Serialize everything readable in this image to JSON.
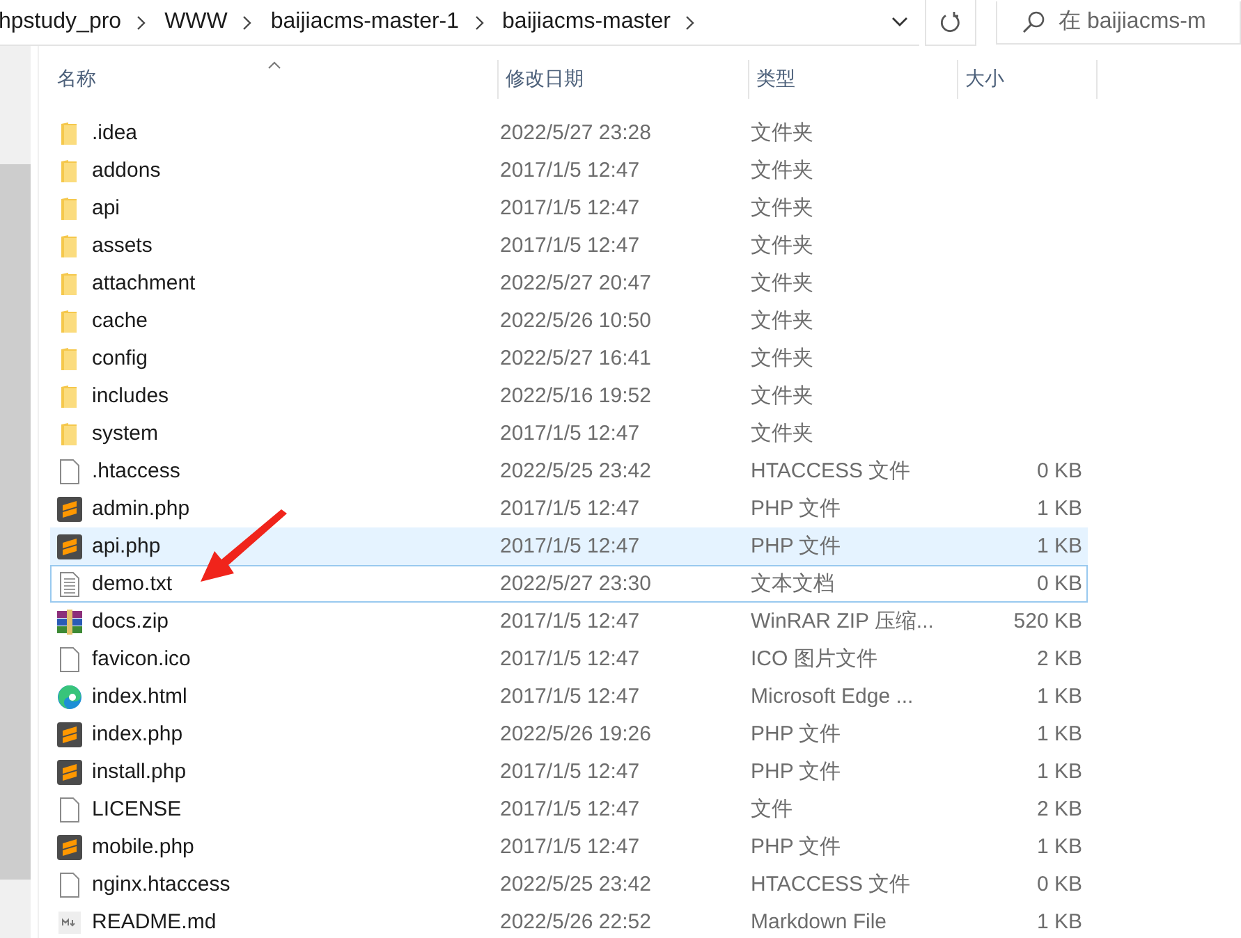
{
  "breadcrumb": [
    "hpstudy_pro",
    "WWW",
    "baijiacms-master-1",
    "baijiacms-master"
  ],
  "search": {
    "placeholder": "在 baijiacms-m"
  },
  "columns": [
    {
      "label": "名称",
      "sorted": true
    },
    {
      "label": "修改日期",
      "sorted": false
    },
    {
      "label": "类型",
      "sorted": false
    },
    {
      "label": "大小",
      "sorted": false
    }
  ],
  "files": [
    {
      "kind": "folder",
      "name": ".idea",
      "modified": "2022/5/27 23:28",
      "type": "文件夹",
      "hovered": false,
      "focused": false
    },
    {
      "kind": "folder",
      "name": "addons",
      "modified": "2017/1/5 12:47",
      "type": "文件夹",
      "hovered": false,
      "focused": false
    },
    {
      "kind": "folder",
      "name": "api",
      "modified": "2017/1/5 12:47",
      "type": "文件夹",
      "hovered": false,
      "focused": false
    },
    {
      "kind": "folder",
      "name": "assets",
      "modified": "2017/1/5 12:47",
      "type": "文件夹",
      "hovered": false,
      "focused": false
    },
    {
      "kind": "folder",
      "name": "attachment",
      "modified": "2022/5/27 20:47",
      "type": "文件夹",
      "hovered": false,
      "focused": false
    },
    {
      "kind": "folder",
      "name": "cache",
      "modified": "2022/5/26 10:50",
      "type": "文件夹",
      "hovered": false,
      "focused": false
    },
    {
      "kind": "folder",
      "name": "config",
      "modified": "2022/5/27 16:41",
      "type": "文件夹",
      "hovered": false,
      "focused": false
    },
    {
      "kind": "folder",
      "name": "includes",
      "modified": "2022/5/16 19:52",
      "type": "文件夹",
      "hovered": false,
      "focused": false
    },
    {
      "kind": "folder",
      "name": "system",
      "modified": "2017/1/5 12:47",
      "type": "文件夹",
      "hovered": false,
      "focused": false
    },
    {
      "kind": "blank",
      "name": ".htaccess",
      "modified": "2022/5/25 23:42",
      "type": "HTACCESS 文件",
      "size": "0 KB",
      "hovered": false,
      "focused": false
    },
    {
      "kind": "php",
      "name": "admin.php",
      "modified": "2017/1/5 12:47",
      "type": "PHP 文件",
      "size": "1 KB",
      "hovered": false,
      "focused": false
    },
    {
      "kind": "php",
      "name": "api.php",
      "modified": "2017/1/5 12:47",
      "type": "PHP 文件",
      "size": "1 KB",
      "hovered": true,
      "focused": false
    },
    {
      "kind": "text",
      "name": "demo.txt",
      "modified": "2022/5/27 23:30",
      "type": "文本文档",
      "size": "0 KB",
      "hovered": false,
      "focused": true
    },
    {
      "kind": "archive",
      "name": "docs.zip",
      "modified": "2017/1/5 12:47",
      "type": "WinRAR ZIP 压缩...",
      "size": "520 KB",
      "hovered": false,
      "focused": false
    },
    {
      "kind": "blank",
      "name": "favicon.ico",
      "modified": "2017/1/5 12:47",
      "type": "ICO 图片文件",
      "size": "2 KB",
      "hovered": false,
      "focused": false
    },
    {
      "kind": "edge",
      "name": "index.html",
      "modified": "2017/1/5 12:47",
      "type": "Microsoft Edge ...",
      "size": "1 KB",
      "hovered": false,
      "focused": false
    },
    {
      "kind": "php",
      "name": "index.php",
      "modified": "2022/5/26 19:26",
      "type": "PHP 文件",
      "size": "1 KB",
      "hovered": false,
      "focused": false
    },
    {
      "kind": "php",
      "name": "install.php",
      "modified": "2017/1/5 12:47",
      "type": "PHP 文件",
      "size": "1 KB",
      "hovered": false,
      "focused": false
    },
    {
      "kind": "blank",
      "name": "LICENSE",
      "modified": "2017/1/5 12:47",
      "type": "文件",
      "size": "2 KB",
      "hovered": false,
      "focused": false
    },
    {
      "kind": "php",
      "name": "mobile.php",
      "modified": "2017/1/5 12:47",
      "type": "PHP 文件",
      "size": "1 KB",
      "hovered": false,
      "focused": false
    },
    {
      "kind": "blank",
      "name": "nginx.htaccess",
      "modified": "2022/5/25 23:42",
      "type": "HTACCESS 文件",
      "size": "0 KB",
      "hovered": false,
      "focused": false
    },
    {
      "kind": "markdown",
      "name": "README.md",
      "modified": "2022/5/26 22:52",
      "type": "Markdown File",
      "size": "1 KB",
      "hovered": false,
      "focused": false
    }
  ]
}
